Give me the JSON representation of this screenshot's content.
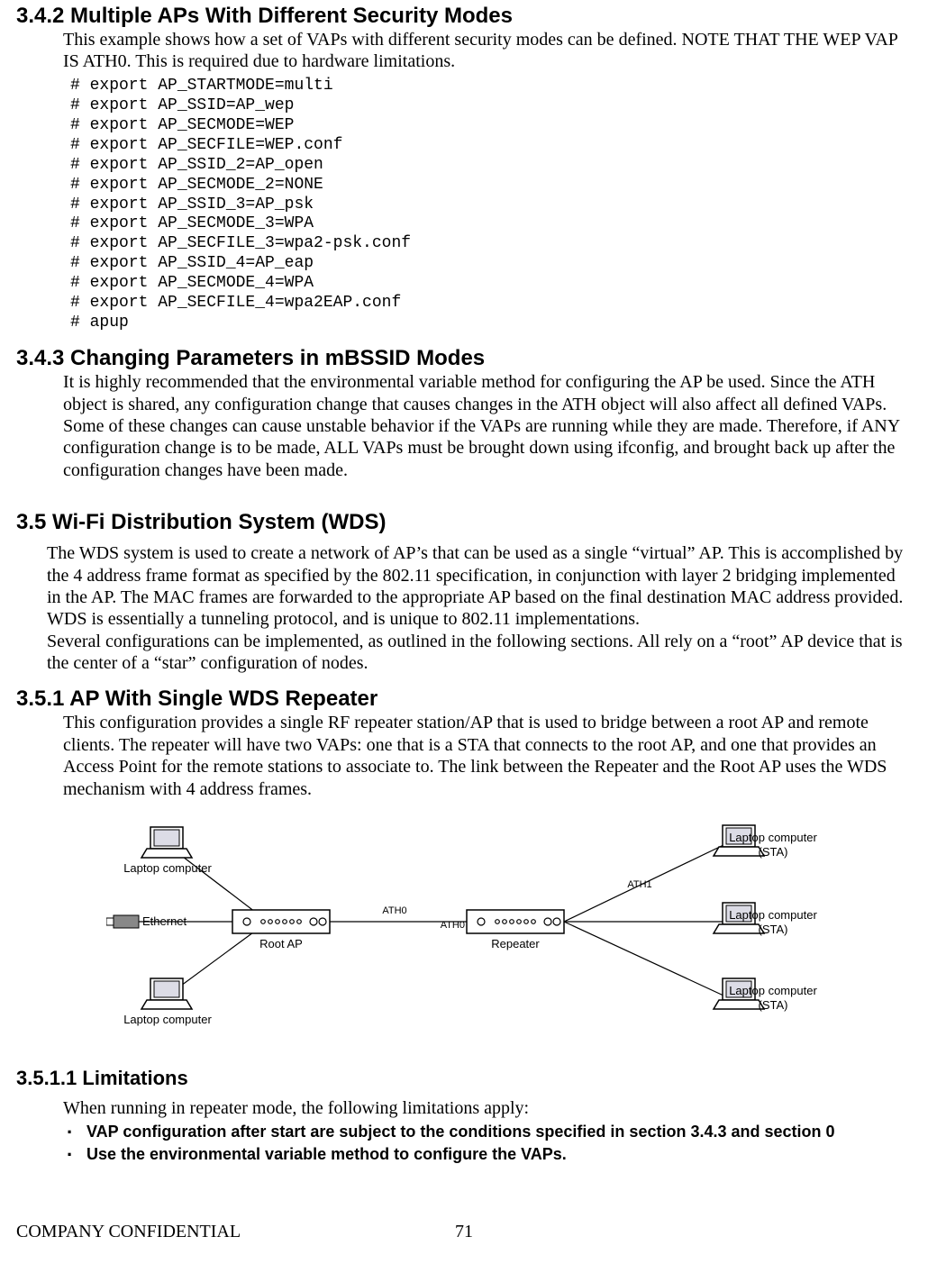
{
  "sections": {
    "s342": {
      "heading": "3.4.2 Multiple APs With Different Security Modes",
      "paragraph": "This example shows how a set of VAPs with different security modes can be defined. NOTE THAT THE WEP VAP IS ATH0. This is required due to hardware limitations.",
      "code": "# export AP_STARTMODE=multi\n# export AP_SSID=AP_wep\n# export AP_SECMODE=WEP\n# export AP_SECFILE=WEP.conf\n# export AP_SSID_2=AP_open\n# export AP_SECMODE_2=NONE\n# export AP_SSID_3=AP_psk\n# export AP_SECMODE_3=WPA\n# export AP_SECFILE_3=wpa2-psk.conf\n# export AP_SSID_4=AP_eap\n# export AP_SECMODE_4=WPA\n# export AP_SECFILE_4=wpa2EAP.conf\n# apup"
    },
    "s343": {
      "heading": "3.4.3 Changing Parameters in mBSSID Modes",
      "paragraph": "It is highly recommended that the environmental variable method for configuring the AP be used. Since the ATH object is shared, any configuration change that causes changes in the ATH object will also affect all defined VAPs. Some of these changes can cause unstable behavior if the VAPs are running while they are made. Therefore, if ANY configuration change is to be made, ALL VAPs must be brought down using ifconfig, and brought back up after the configuration changes have been made."
    },
    "s35": {
      "heading": "3.5 Wi-Fi Distribution System (WDS)",
      "paragraph1": "The WDS system is used to create a network of AP’s that can be used as a single “virtual” AP. This is accomplished by the 4 address frame format as specified by the 802.11 specification, in conjunction with layer 2 bridging implemented in the AP. The MAC frames are forwarded to the appropriate AP based on the final destination MAC address provided. WDS is essentially a tunneling protocol, and is unique to 802.11 implementations.",
      "paragraph2": "Several configurations can be implemented, as outlined in the following sections. All rely on a “root” AP device that is the center of a “star” configuration of nodes."
    },
    "s351": {
      "heading": "3.5.1 AP With Single WDS Repeater",
      "paragraph": "This configuration provides a single RF repeater station/AP that is used to bridge between a root AP and remote clients. The repeater will have two VAPs: one that is a STA that connects to the root AP, and one that provides an Access Point for the remote stations to associate to. The link between the Repeater and the Root AP uses the WDS mechanism with 4 address frames."
    },
    "s3511": {
      "heading": "3.5.1.1 Limitations",
      "intro": "When running in repeater mode, the following limitations apply:",
      "bullets": [
        "VAP configuration after start are subject to the conditions specified in section 3.4.3 and section 0",
        "Use the environmental variable method to configure the VAPs."
      ]
    }
  },
  "diagram": {
    "labels": {
      "laptop_left_top": "Laptop computer",
      "laptop_left_bottom": "Laptop computer",
      "ethernet": "Ethernet",
      "root_ap": "Root AP",
      "ath0_left": "ATH0",
      "ath0_right": "ATH0",
      "repeater": "Repeater",
      "ath1": "ATH1",
      "sta1": "Laptop computer",
      "sta1_sub": "(STA)",
      "sta2": "Laptop computer",
      "sta2_sub": "(STA)",
      "sta3": "Laptop computer",
      "sta3_sub": "(STA)"
    }
  },
  "footer": {
    "left": "COMPANY CONFIDENTIAL",
    "page": "71"
  }
}
